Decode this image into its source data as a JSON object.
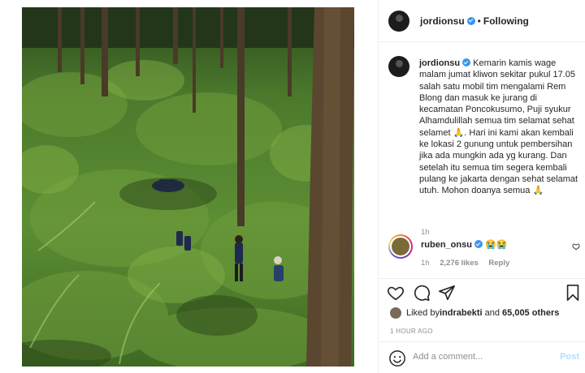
{
  "post": {
    "photo_alt": "",
    "author": {
      "username": "jordionsu",
      "verified": true,
      "follow_status": "Following",
      "separator": "•"
    },
    "caption": {
      "username": "jordionsu",
      "text_1": "Kemarin kamis wage malam jumat kliwon sekitar pukul 17.05 salah satu mobil tim mengalami Rem Blong dan masuk ke jurang di kecamatan Poncokusumo, Puji syukur Alhamdulillah semua tim selamat sehat selamet ",
      "emoji_1": "🙏",
      "text_2": ". Hari ini kami akan kembali ke lokasi 2 gunung untuk pembersihan jika ada mungkin ada yg kurang. Dan setelah itu semua tim segera kembali pulang ke jakarta dengan sehat selamat utuh. Mohon doanya semua ",
      "emoji_2": "🙏",
      "time": "1h"
    },
    "comments": [
      {
        "username": "ruben_onsu",
        "verified": true,
        "emojis": [
          "😭",
          "😭"
        ],
        "time": "1h",
        "likes": "2,276 likes",
        "reply": "Reply"
      }
    ],
    "likes": {
      "prefix": "Liked by ",
      "user": "indrabekti",
      "middle": " and ",
      "others": "65,005 others"
    },
    "timestamp": "1 HOUR AGO",
    "add_comment": {
      "placeholder": "Add a comment...",
      "post_label": "Post"
    },
    "icons": {
      "like": "heart-icon",
      "comment": "comment-icon",
      "share": "share-icon",
      "save": "bookmark-icon",
      "emoji": "smiley-icon"
    },
    "colors": {
      "verified": "#3897f0",
      "muted": "#8e8e8e",
      "post_disabled": "#b2dffc",
      "text": "#262626"
    }
  }
}
